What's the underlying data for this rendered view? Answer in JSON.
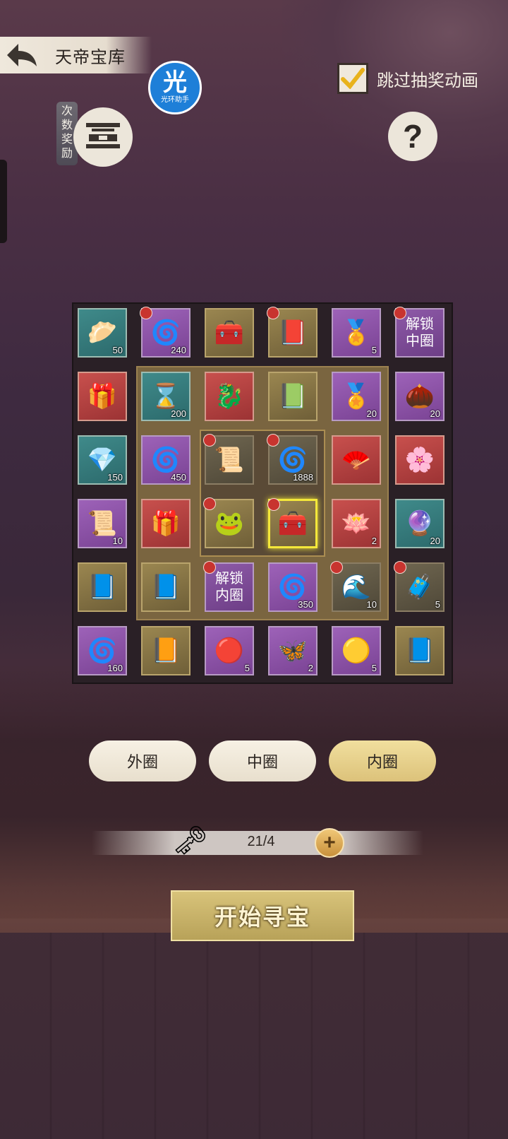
{
  "header": {
    "title": "天帝宝库",
    "back_icon": "back-arrow-icon"
  },
  "helper_badge": {
    "glyph": "光",
    "caption": "光环助手"
  },
  "reward": {
    "tag": "次数奖励"
  },
  "skip_animation": {
    "label": "跳过抽奖动画",
    "checked": true
  },
  "help": {
    "glyph": "?"
  },
  "grid": {
    "cells": [
      {
        "icon": "gold-bun-icon",
        "qty": "50",
        "theme": "teal",
        "locked": false
      },
      {
        "icon": "jade-pendant-icon",
        "qty": "240",
        "theme": "purple",
        "locked": true
      },
      {
        "icon": "gold-chest-icon",
        "qty": "",
        "theme": "gold",
        "locked": false
      },
      {
        "icon": "purple-book-icon",
        "qty": "",
        "theme": "gold",
        "locked": true
      },
      {
        "icon": "gold-token-icon",
        "qty": "5",
        "theme": "purple",
        "locked": false
      },
      {
        "icon": "unlock-text",
        "text": "解锁\n中圈",
        "qty": "",
        "theme": "locked",
        "locked": true
      },
      {
        "icon": "purple-chest-icon",
        "qty": "",
        "theme": "red",
        "locked": false
      },
      {
        "icon": "hourglass-icon",
        "qty": "200",
        "theme": "teal",
        "locked": false
      },
      {
        "icon": "gold-beast-icon",
        "qty": "",
        "theme": "red",
        "locked": false
      },
      {
        "icon": "green-book-icon",
        "qty": "",
        "theme": "gold",
        "locked": false
      },
      {
        "icon": "gold-token-icon",
        "qty": "20",
        "theme": "purple",
        "locked": false
      },
      {
        "icon": "seeds-icon",
        "qty": "20",
        "theme": "purple",
        "locked": false
      },
      {
        "icon": "ore-icon",
        "qty": "150",
        "theme": "teal",
        "locked": false
      },
      {
        "icon": "jade-pendant-icon",
        "qty": "450",
        "theme": "purple",
        "locked": false
      },
      {
        "icon": "scroll-map-icon",
        "qty": "",
        "theme": "dim",
        "locked": true
      },
      {
        "icon": "jade-pendant-icon",
        "qty": "1888",
        "theme": "dim",
        "locked": true
      },
      {
        "icon": "red-fan-icon",
        "qty": "",
        "theme": "red",
        "locked": false
      },
      {
        "icon": "flower-orb-icon",
        "qty": "",
        "theme": "red",
        "locked": false
      },
      {
        "icon": "bamboo-scroll-icon",
        "qty": "10",
        "theme": "purple",
        "locked": false
      },
      {
        "icon": "treasure-chest-icon",
        "qty": "",
        "theme": "red",
        "locked": false
      },
      {
        "icon": "frog-avatar-icon",
        "qty": "",
        "theme": "gold",
        "locked": true
      },
      {
        "icon": "gold-chest-icon",
        "qty": "",
        "theme": "gold",
        "locked": true,
        "selected": true
      },
      {
        "icon": "lotus-icon",
        "qty": "2",
        "theme": "red",
        "locked": false
      },
      {
        "icon": "crystal-ball-icon",
        "qty": "20",
        "theme": "teal",
        "locked": false
      },
      {
        "icon": "teal-book-icon",
        "qty": "",
        "theme": "gold",
        "locked": false
      },
      {
        "icon": "blue-book-icon",
        "qty": "",
        "theme": "gold",
        "locked": false
      },
      {
        "icon": "unlock-text",
        "text": "解锁\n内圈",
        "qty": "",
        "theme": "locked",
        "locked": true
      },
      {
        "icon": "jade-pendant-icon",
        "qty": "350",
        "theme": "purple",
        "locked": false
      },
      {
        "icon": "water-swirl-icon",
        "qty": "10",
        "theme": "dim",
        "locked": true
      },
      {
        "icon": "wood-chest-icon",
        "qty": "5",
        "theme": "dim",
        "locked": true
      },
      {
        "icon": "jade-pendant-icon",
        "qty": "160",
        "theme": "purple",
        "locked": false
      },
      {
        "icon": "red-book-icon",
        "qty": "",
        "theme": "gold",
        "locked": false
      },
      {
        "icon": "red-orb-icon",
        "qty": "5",
        "theme": "purple",
        "locked": false
      },
      {
        "icon": "butterfly-icon",
        "qty": "2",
        "theme": "purple",
        "locked": false
      },
      {
        "icon": "gold-orb-icon",
        "qty": "5",
        "theme": "purple",
        "locked": false
      },
      {
        "icon": "blue-book-icon",
        "qty": "",
        "theme": "gold",
        "locked": false
      }
    ]
  },
  "ring_tabs": [
    {
      "label": "外圈",
      "active": false
    },
    {
      "label": "中圈",
      "active": false
    },
    {
      "label": "内圈",
      "active": true
    }
  ],
  "keys": {
    "count": "21/4",
    "icon": "key-icon",
    "add_icon": "plus-icon"
  },
  "start": {
    "label": "开始寻宝"
  }
}
